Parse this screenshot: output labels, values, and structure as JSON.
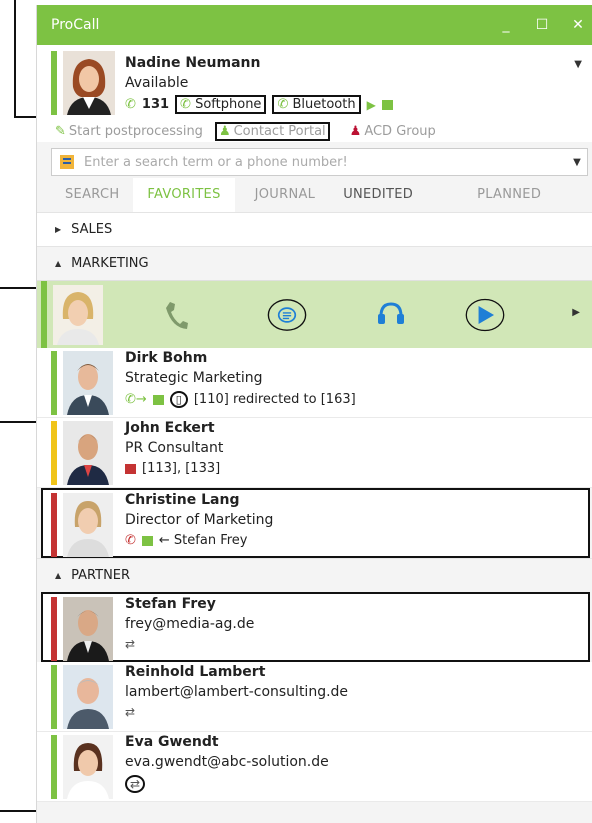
{
  "window": {
    "title": "ProCall"
  },
  "user": {
    "name": "Nadine Neumann",
    "status": "Available",
    "extension": "131",
    "softphone_label": "Softphone",
    "bluetooth_label": "Bluetooth"
  },
  "actions": {
    "postprocessing": "Start postprocessing",
    "contact_portal": "Contact Portal",
    "acd_group": "ACD Group"
  },
  "search": {
    "placeholder": "Enter a search term or a phone number!"
  },
  "tabs": [
    "SEARCH",
    "FAVORITES",
    "JOURNAL",
    "UNEDITED",
    "PLANNED"
  ],
  "groups": {
    "sales": "SALES",
    "marketing": "MARKETING",
    "partner": "PARTNER"
  },
  "contacts": [
    {
      "name": "Dirk Bohm",
      "line2": "Strategic Marketing",
      "line3": "[110] redirected to [163]",
      "presence": "#7dc243"
    },
    {
      "name": "John Eckert",
      "line2": "PR Consultant",
      "line3": "[113], [133]",
      "presence": "#f0c419"
    },
    {
      "name": "Christine Lang",
      "line2": "Director of Marketing",
      "line3": "← Stefan Frey",
      "presence": "#c43333"
    },
    {
      "name": "Stefan Frey",
      "line2": "frey@media-ag.de",
      "line3": "",
      "presence": "#c43333"
    },
    {
      "name": "Reinhold Lambert",
      "line2": "lambert@lambert-consulting.de",
      "line3": "",
      "presence": "#7dc243"
    },
    {
      "name": "Eva Gwendt",
      "line2": "eva.gwendt@abc-solution.de",
      "line3": "",
      "presence": "#7dc243"
    }
  ],
  "colors": {
    "accent": "#7dc243",
    "busy": "#c43333",
    "away": "#f0c419",
    "action_blue": "#1f7fd6"
  },
  "icons": [
    "phone-icon",
    "chat-icon",
    "headset-icon",
    "play-icon",
    "calendar-icon",
    "mobile-icon",
    "group-icon"
  ]
}
